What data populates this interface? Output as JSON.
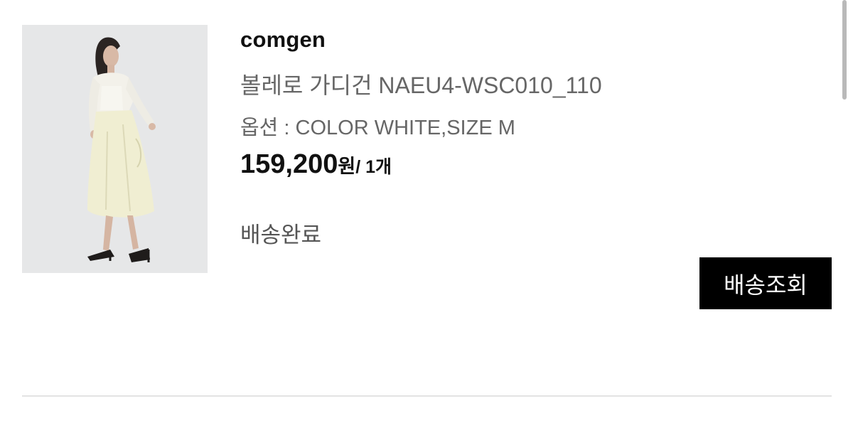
{
  "order_item": {
    "image_alt": "product-photo",
    "brand": "comgen",
    "product_name": "볼레로 가디건 NAEU4-WSC010_110",
    "option": "옵션 : COLOR WHITE,SIZE M",
    "price": "159,200",
    "price_unit": "원",
    "quantity": "/ 1개",
    "status": "배송완료",
    "track_button_label": "배송조회"
  },
  "colors": {
    "button_bg": "#000000",
    "button_text": "#ffffff",
    "text_primary": "#111111",
    "text_secondary": "#666666",
    "divider": "#e3e3e3"
  }
}
